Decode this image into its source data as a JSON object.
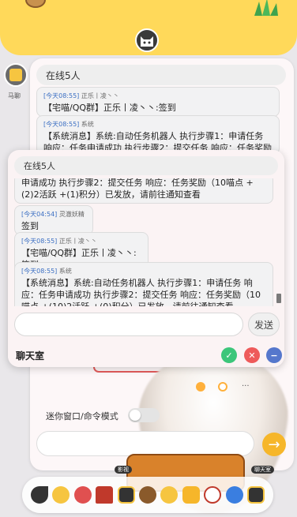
{
  "background_chat": {
    "online": "在线5人",
    "sidebar_label": "马聊",
    "messages": [
      {
        "time": "[今天08:55]",
        "name": "正乐丨凌丶丶",
        "text": "【宅喵/QQ群】正乐丨凌丶丶:签到"
      },
      {
        "time": "[今天08:55]",
        "name": "系统",
        "text": "【系统消息】系统:自动任务机器人 执行步骤1：申请任务 响应：任务申请成功 执行步骤2：提交任务 响应：任务奖励（10喵点 +(1"
      }
    ],
    "mini_mode_label": "迷你窗口/命令模式",
    "dock_label_left": "影视",
    "dock_label_right": "聊天室",
    "send_arrow": "→",
    "more": "···"
  },
  "front_chat": {
    "online": "在线5人",
    "messages": [
      {
        "time": "",
        "name": "",
        "text": "申请成功 执行步骤2：提交任务 响应：任务奖励（10喵点 +(2)2活跃 +(1)积分）已发放，请前往通知查看"
      },
      {
        "time": "[今天04:54]",
        "name": "灵澈妖精",
        "text": "签到"
      },
      {
        "time": "[今天08:55]",
        "name": "正乐丨凌丶丶",
        "text": "【宅喵/QQ群】正乐丨凌丶丶:签到"
      },
      {
        "time": "[今天08:55]",
        "name": "系统",
        "text": "【系统消息】系统:自动任务机器人 执行步骤1：申请任务 响应：任务申请成功 执行步骤2：提交任务 响应：任务奖励（10喵点 +(10)2活跃 +(0)积分）已发放，请前往通知查看"
      }
    ],
    "send_label": "发送",
    "title": "聊天室",
    "controls": {
      "confirm": "✓",
      "close": "✕",
      "minimize": "−"
    }
  },
  "colors": {
    "accent_yellow": "#ffd95a",
    "green": "#3cc67a",
    "red": "#ee5a5a",
    "blue": "#5577cc",
    "link_blue": "#3b6fc3"
  }
}
